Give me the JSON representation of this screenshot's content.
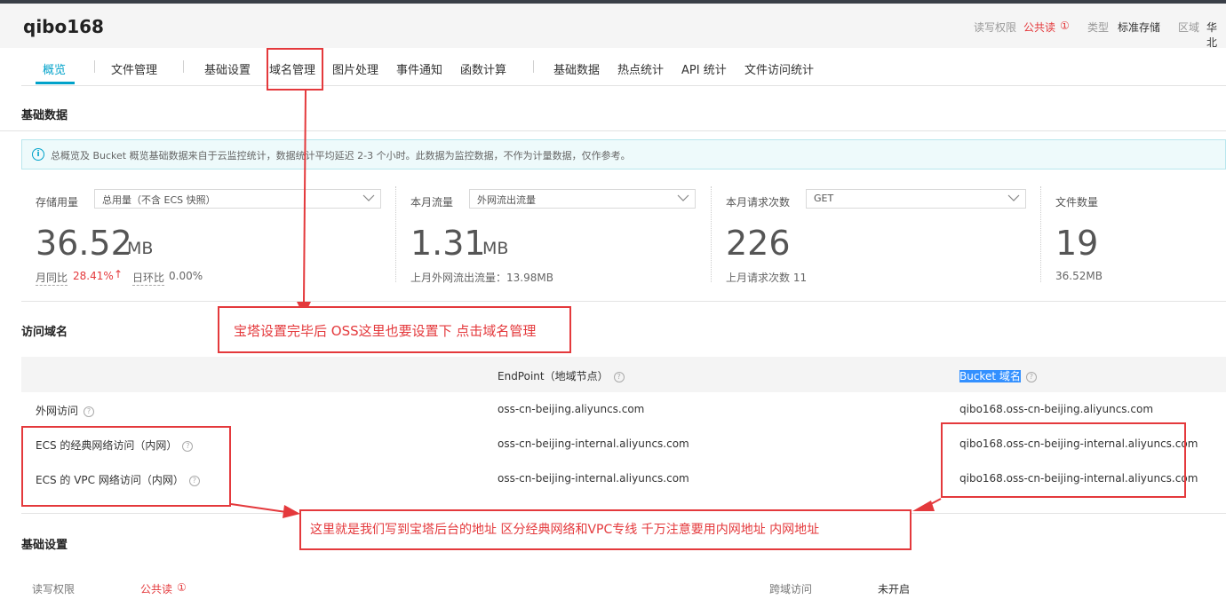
{
  "header": {
    "bucket_name": "qibo168",
    "permission_label": "读写权限",
    "permission_value": "公共读",
    "warn_icon": "①",
    "type_label": "类型",
    "type_value": "标准存储",
    "region_label": "区域",
    "region_value": "华北"
  },
  "tabs": [
    "概览",
    "文件管理",
    "基础设置",
    "域名管理",
    "图片处理",
    "事件通知",
    "函数计算",
    "基础数据",
    "热点统计",
    "API 统计",
    "文件访问统计"
  ],
  "basic_data": {
    "title": "基础数据",
    "info_icon": "i",
    "info_text": "总概览及 Bucket 概览基础数据来自于云监控统计，数据统计平均延迟 2-3 个小时。此数据为监控数据，不作为计量数据，仅作参考。",
    "storage": {
      "label": "存储用量",
      "select": "总用量（不含 ECS 快照）",
      "value": "36.52",
      "unit": "MB",
      "yoy_label": "月同比",
      "yoy_value": "28.41%",
      "yoy_arrow": "↑",
      "mom_label": "日环比",
      "mom_value": "0.00%"
    },
    "traffic": {
      "label": "本月流量",
      "select": "外网流出流量",
      "value": "1.31",
      "unit": "MB",
      "sub": "上月外网流出流量：13.98MB"
    },
    "requests": {
      "label": "本月请求次数",
      "select": "GET",
      "value": "226",
      "sub": "上月请求次数  11"
    },
    "files": {
      "label": "文件数量",
      "value": "19",
      "sub": "36.52MB"
    }
  },
  "access_domain": {
    "title": "访问域名",
    "col_endpoint": "EndPoint（地域节点）",
    "col_bucket": "Bucket 域名",
    "help_icon": "?",
    "rows": [
      {
        "type": "外网访问",
        "endpoint": "oss-cn-beijing.aliyuncs.com",
        "bucket": "qibo168.oss-cn-beijing.aliyuncs.com"
      },
      {
        "type": "ECS 的经典网络访问（内网）",
        "endpoint": "oss-cn-beijing-internal.aliyuncs.com",
        "bucket": "qibo168.oss-cn-beijing-internal.aliyuncs.com"
      },
      {
        "type": "ECS 的 VPC 网络访问（内网）",
        "endpoint": "oss-cn-beijing-internal.aliyuncs.com",
        "bucket": "qibo168.oss-cn-beijing-internal.aliyuncs.com"
      }
    ]
  },
  "basic_settings": {
    "title": "基础设置",
    "rw_label": "读写权限",
    "rw_value": "公共读",
    "warn_icon": "①",
    "cors_label": "跨域访问",
    "cors_value": "未开启"
  },
  "annotations": {
    "callout1": "宝塔设置完毕后 OSS这里也要设置下 点击域名管理",
    "callout2": "这里就是我们写到宝塔后台的地址 区分经典网络和VPC专线 千万注意要用内网地址 内网地址"
  },
  "colors": {
    "accent": "#00a2ca",
    "annotation_red": "#e4393c",
    "warning_red": "#e4393c"
  }
}
